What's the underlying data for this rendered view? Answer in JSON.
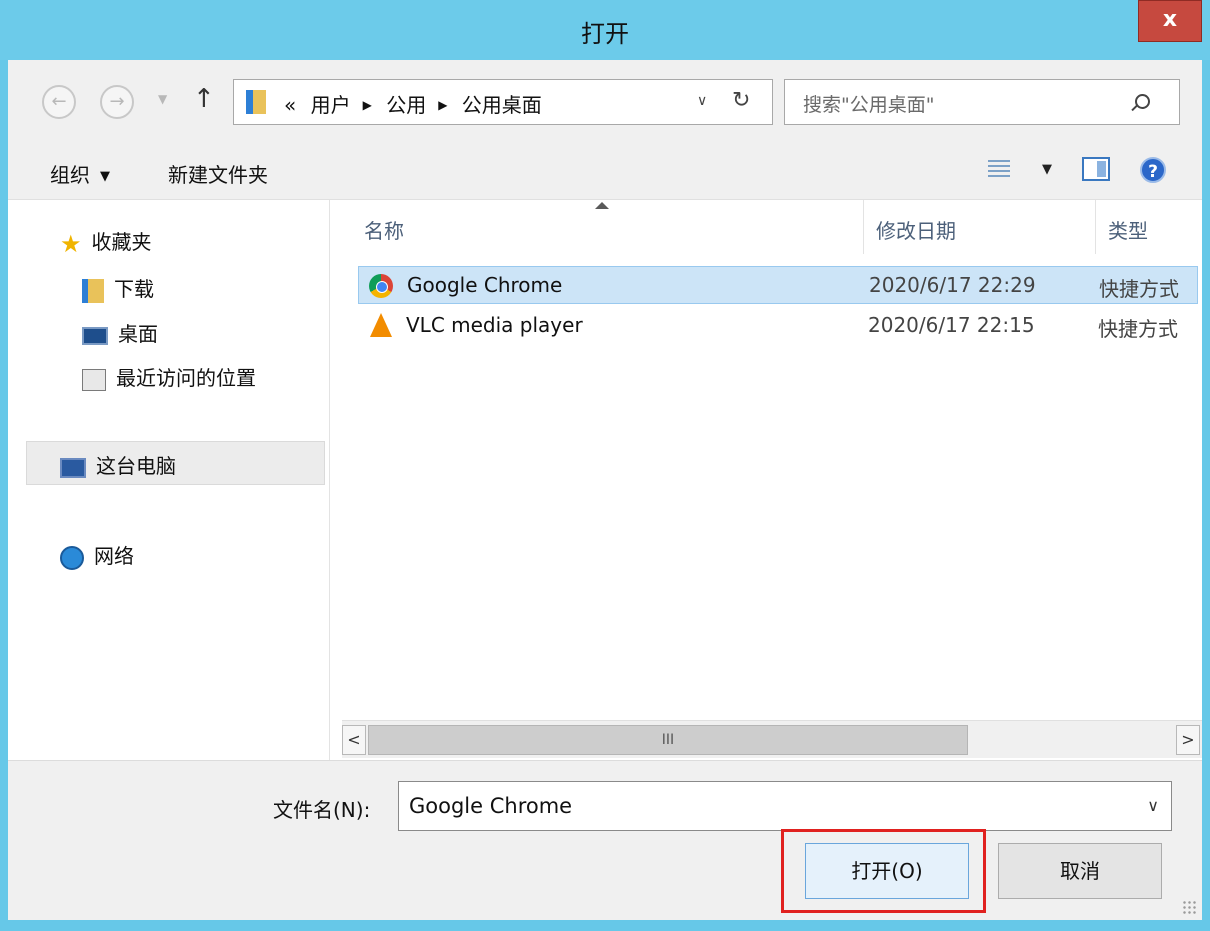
{
  "window": {
    "title": "打开",
    "close_label": "x"
  },
  "navigation": {
    "back_glyph": "←",
    "forward_glyph": "→",
    "up_glyph": "↑",
    "breadcrumb": {
      "overflow": "«",
      "items": [
        "用户",
        "公用",
        "公用桌面"
      ]
    },
    "search_placeholder": "搜索\"公用桌面\""
  },
  "toolbar": {
    "organize_label": "组织",
    "new_folder_label": "新建文件夹"
  },
  "sidebar": {
    "favorites": {
      "label": "收藏夹",
      "icon": "star-icon"
    },
    "favorite_items": [
      {
        "label": "下载",
        "icon": "downloads-folder-icon"
      },
      {
        "label": "桌面",
        "icon": "desktop-icon"
      },
      {
        "label": "最近访问的位置",
        "icon": "recent-places-icon"
      }
    ],
    "this_pc": {
      "label": "这台电脑",
      "icon": "computer-icon",
      "selected": true
    },
    "network": {
      "label": "网络",
      "icon": "network-icon"
    }
  },
  "file_list": {
    "columns": [
      "名称",
      "修改日期",
      "类型"
    ],
    "sort_column": "名称",
    "rows": [
      {
        "name": "Google Chrome",
        "date": "2020/6/17 22:29",
        "type": "快捷方式",
        "icon": "chrome-shortcut-icon",
        "selected": true
      },
      {
        "name": "VLC media player",
        "date": "2020/6/17 22:15",
        "type": "快捷方式",
        "icon": "vlc-shortcut-icon",
        "selected": false
      }
    ],
    "scrollbar_thumb_label": "III"
  },
  "footer": {
    "filename_label": "文件名(N):",
    "filename_value": "Google Chrome",
    "open_button": "打开(O)",
    "cancel_button": "取消"
  },
  "colors": {
    "title_bar": "#6ccbea",
    "close_button": "#c6493f",
    "selection": "#cce4f7",
    "highlight_box": "#e0211f"
  }
}
